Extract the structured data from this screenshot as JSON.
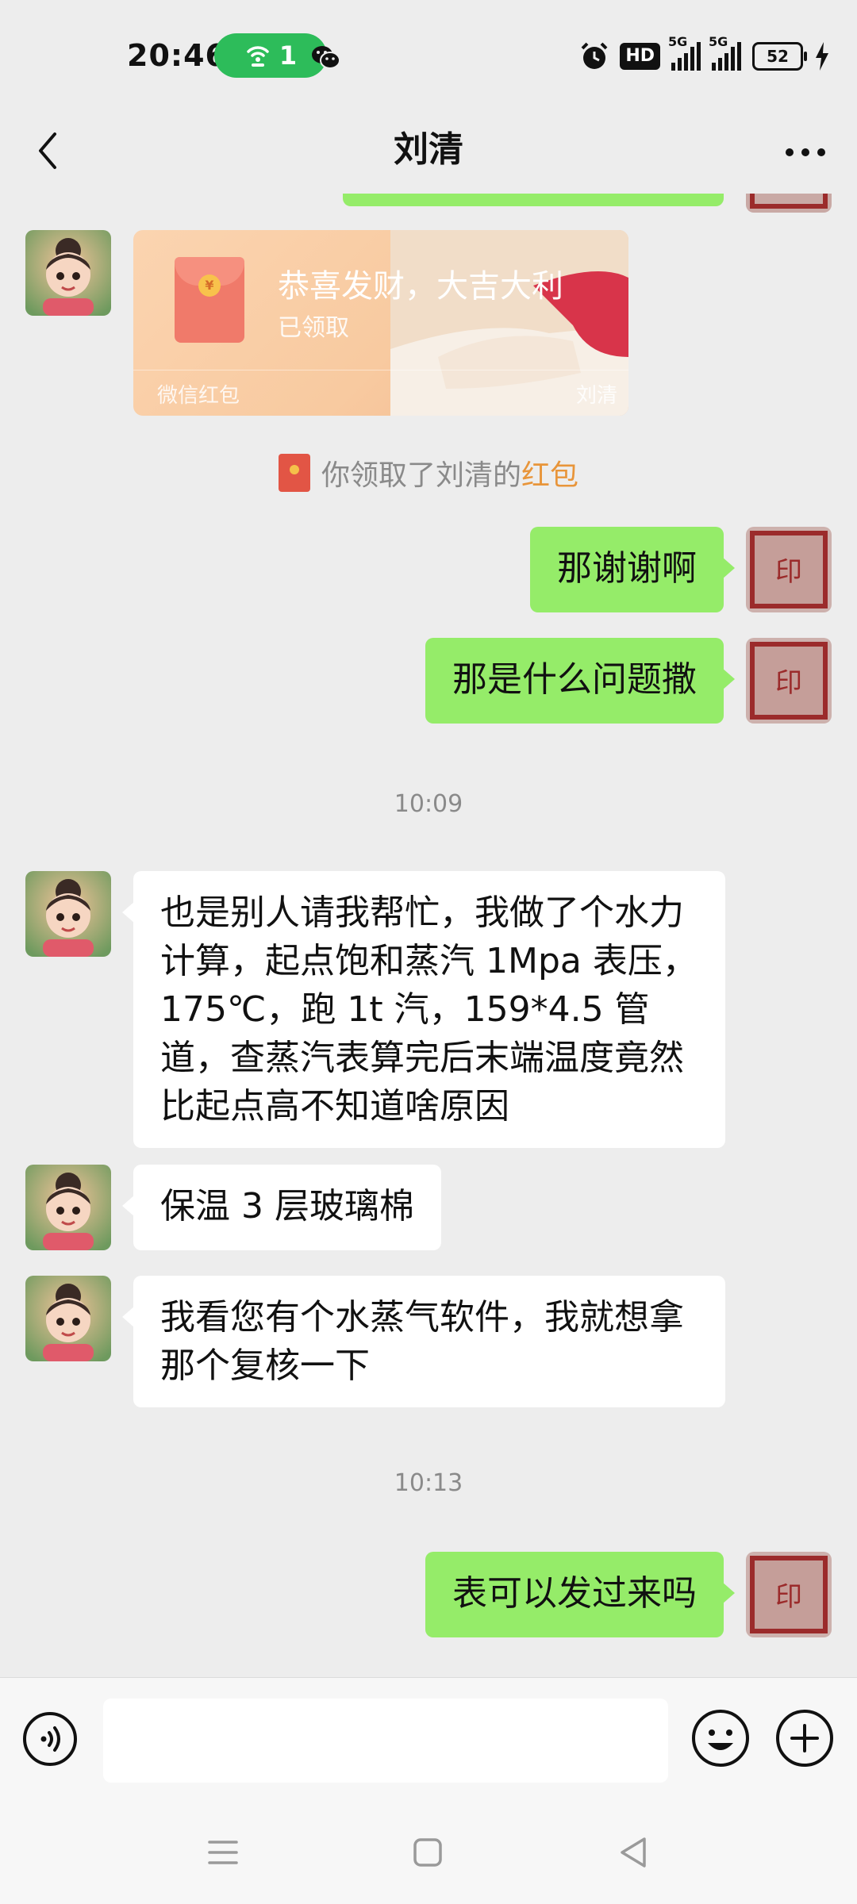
{
  "status_bar": {
    "time": "20:46",
    "hotspot_count": "1",
    "hd_label": "HD",
    "signal_1_label": "5G",
    "signal_2_label": "5G",
    "battery": "52"
  },
  "header": {
    "title": "刘清"
  },
  "red_packet": {
    "title": "恭喜发财，大吉大利",
    "status": "已领取",
    "brand": "微信红包",
    "sender": "刘清"
  },
  "system_notice": {
    "prefix": "你领取了刘清的",
    "link": "红包"
  },
  "messages": [
    {
      "side": "out",
      "text": "那谢谢啊"
    },
    {
      "side": "out",
      "text": "那是什么问题撒"
    },
    {
      "side": "in",
      "text": "也是别人请我帮忙，我做了个水力计算，起点饱和蒸汽 1Mpa 表压，175℃，跑 1t 汽，159*4.5 管道，查蒸汽表算完后末端温度竟然比起点高不知道啥原因"
    },
    {
      "side": "in",
      "text": "保温 3 层玻璃棉"
    },
    {
      "side": "in",
      "text": "我看您有个水蒸气软件，我就想拿那个复核一下"
    },
    {
      "side": "out",
      "text": "表可以发过来吗"
    }
  ],
  "timestamps": [
    "10:09",
    "10:13"
  ],
  "colors": {
    "outgoing_bubble": "#95ec69",
    "incoming_bubble": "#ffffff",
    "background": "#ededed",
    "hotspot_pill": "#2dbc5a",
    "notice_link": "#e8953a"
  }
}
